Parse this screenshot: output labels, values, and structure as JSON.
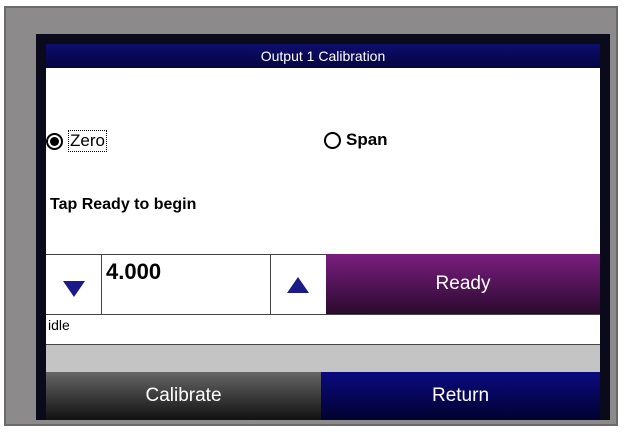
{
  "window": {
    "title": "Output 1 Calibration"
  },
  "mode": {
    "selected": "Zero",
    "options": [
      {
        "label": "Zero",
        "selected": true
      },
      {
        "label": "Span",
        "selected": false
      }
    ]
  },
  "prompt": "Tap Ready to begin",
  "value": "4.000",
  "buttons": {
    "ready": "Ready",
    "calibrate": "Calibrate",
    "return": "Return"
  },
  "status": "idle",
  "progress": {
    "fraction": 0
  },
  "icons": {
    "decrement": "down-triangle-icon",
    "increment": "up-triangle-icon"
  },
  "colors": {
    "title_bar": "#0d0d6e",
    "ready_button": "#7a1e80",
    "calibrate_button": "#333333",
    "return_button": "#0a0a80",
    "arrow": "#1a1a8a",
    "bezel": "#8c8a8b"
  }
}
